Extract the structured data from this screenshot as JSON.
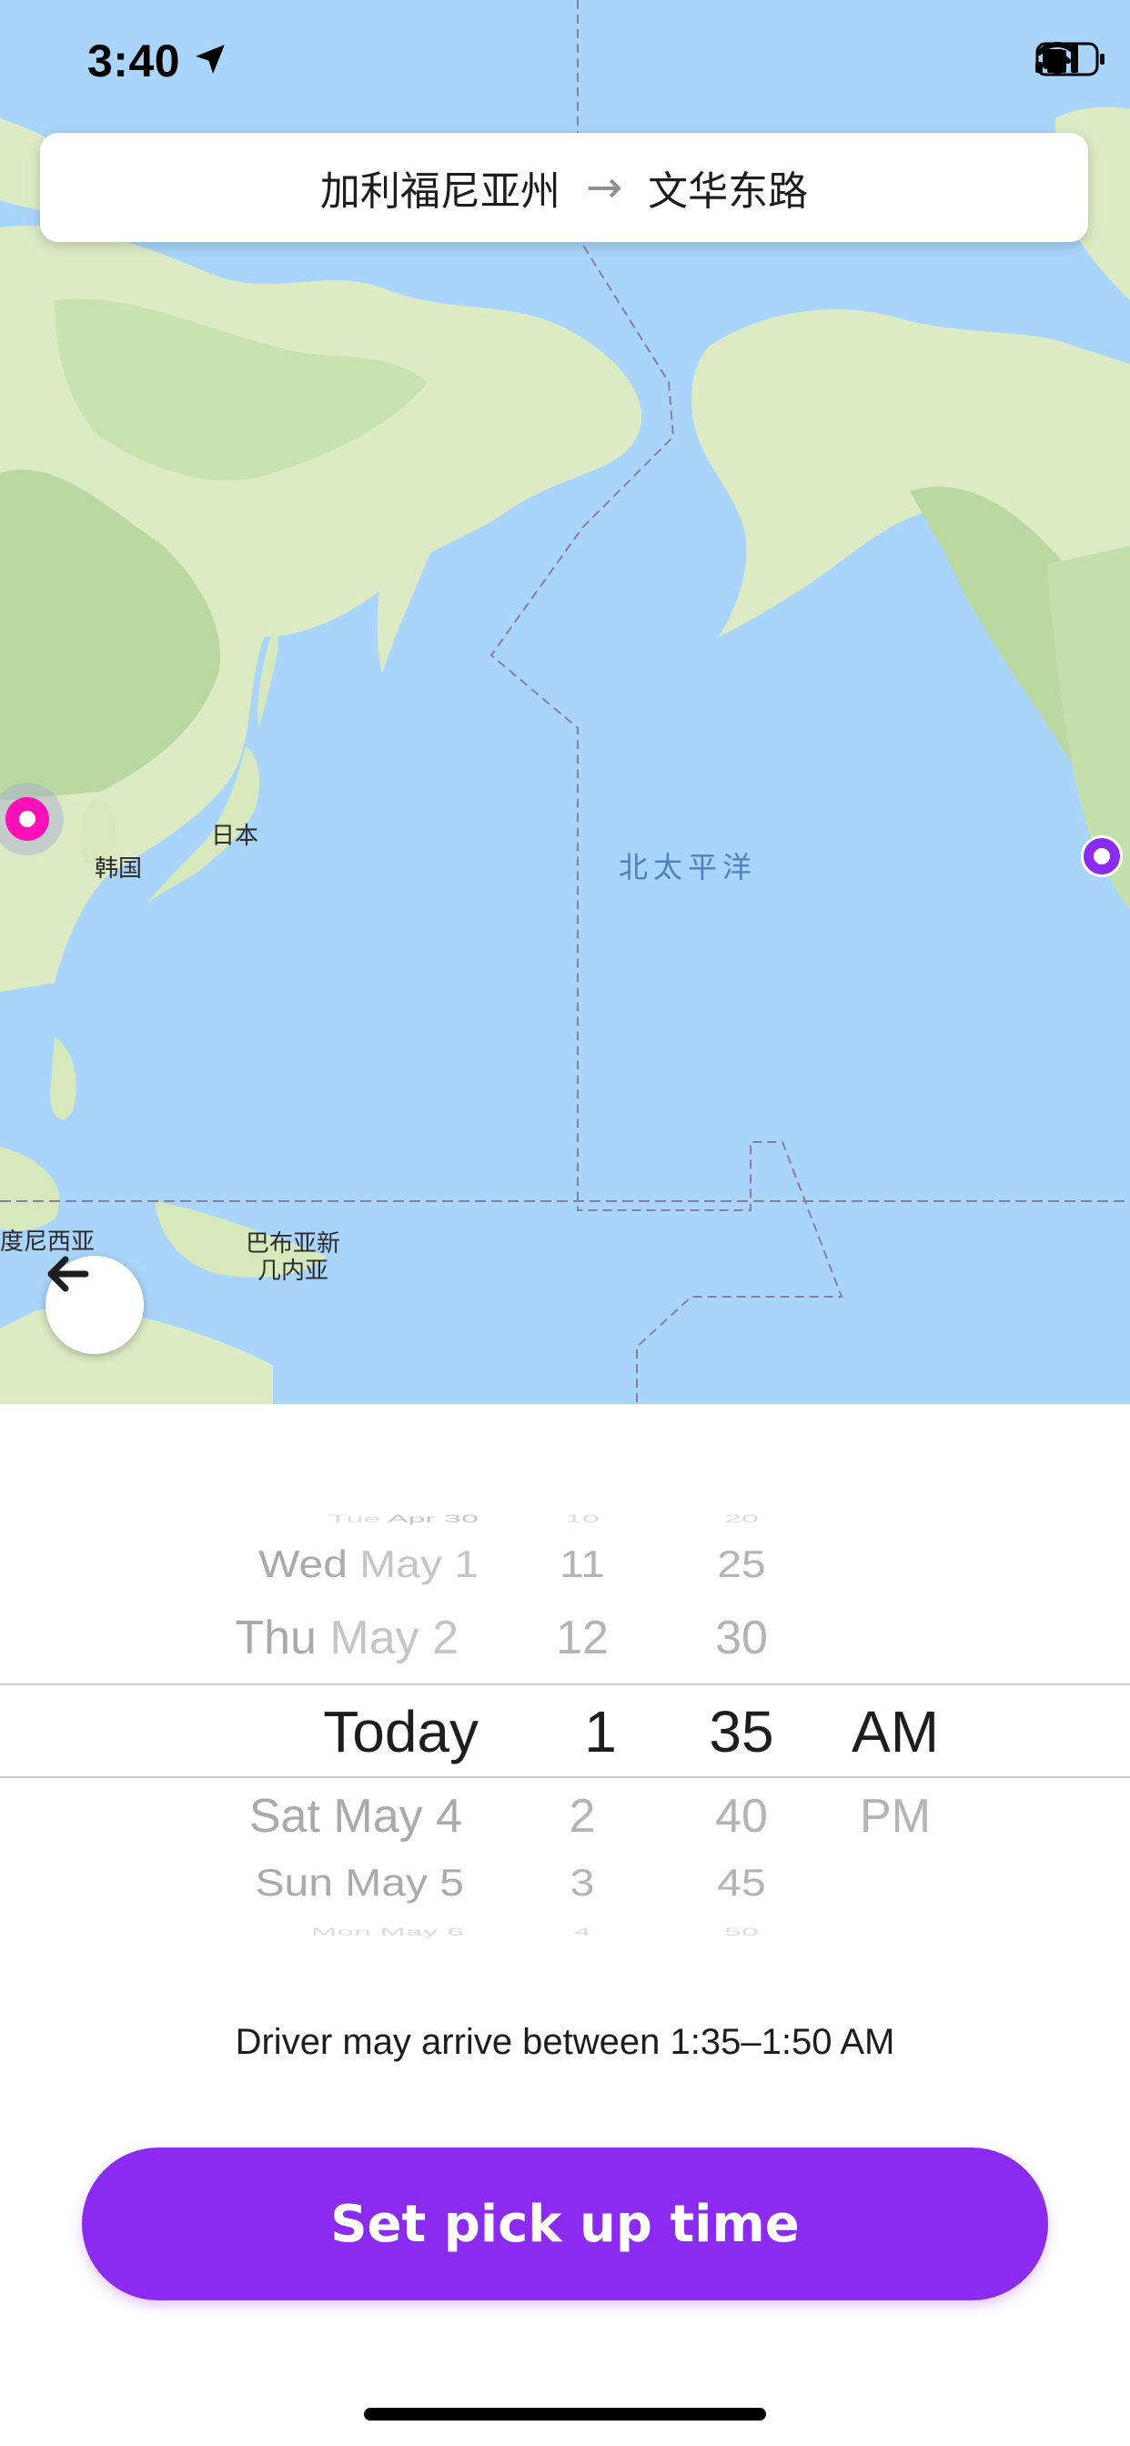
{
  "status_bar": {
    "time": "3:40"
  },
  "route": {
    "origin": "加利福尼亚州",
    "arrow": "→",
    "destination": "文华东路"
  },
  "map": {
    "labels": {
      "japan": "日本",
      "korea": "韩国",
      "north_pacific": "北太平洋",
      "indonesia": "度尼西亚",
      "papua": "巴布亚新\n几内亚"
    },
    "colors": {
      "ocean": "#a9d4fb",
      "land": "#dcebc4",
      "forest": "#b7d9a2",
      "origin_marker": "#ff0fb8",
      "destination_marker": "#8c2bf0"
    }
  },
  "picker": {
    "days": [
      {
        "weekday": "Tue",
        "date": "Apr 30"
      },
      {
        "weekday": "Wed",
        "date": "May 1"
      },
      {
        "weekday": "Thu",
        "date": "May 2"
      },
      {
        "weekday": "",
        "date": "Today"
      },
      {
        "weekday": "Sat",
        "date": "May 4"
      },
      {
        "weekday": "Sun",
        "date": "May 5"
      },
      {
        "weekday": "Mon",
        "date": "May 6"
      }
    ],
    "hours": [
      "10",
      "11",
      "12",
      "1",
      "2",
      "3",
      "4"
    ],
    "minutes": [
      "20",
      "25",
      "30",
      "35",
      "40",
      "45",
      "50"
    ],
    "periods": [
      "AM",
      "PM"
    ],
    "selected": {
      "day": "Today",
      "hour": "1",
      "minute": "35",
      "period": "AM"
    }
  },
  "arrival_note": "Driver may arrive between 1:35–1:50 AM",
  "set_button_label": "Set pick up time",
  "accent_color": "#8c2bf0"
}
